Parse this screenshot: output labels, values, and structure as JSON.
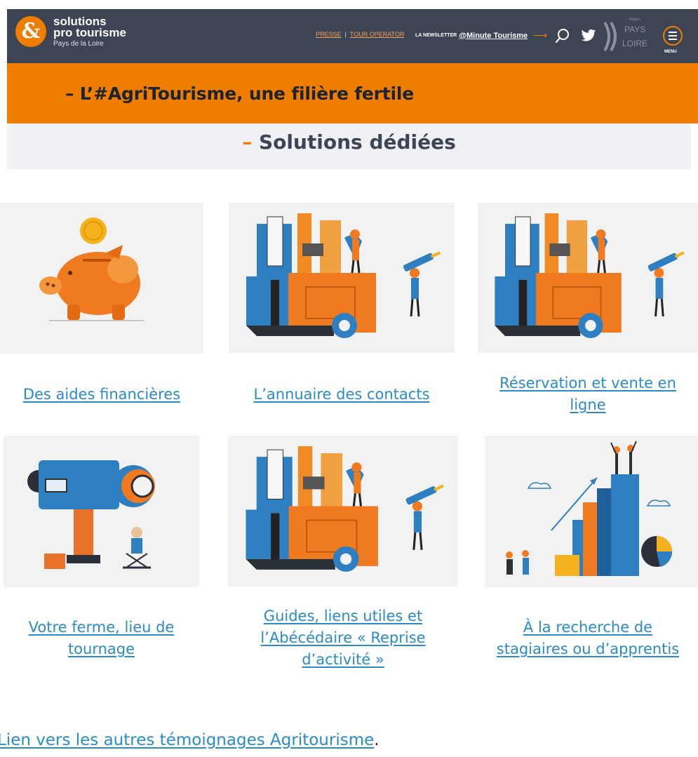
{
  "header": {
    "logo_symbol": "&",
    "logo_line1": "solutions",
    "logo_line2": "pro tourisme",
    "logo_sub": "Pays de la Loire",
    "link_presse": "PRESSE",
    "separator": "|",
    "link_tour_operator": "TOUR OPERATOR",
    "newsletter_prefix": "LA NEWSLETTER",
    "newsletter_name": "@Minute Tourisme",
    "newsletter_arrow": "⟶",
    "region_word": "Région",
    "region_pays": "PAYS",
    "region_loire": "LOIRE",
    "menu_label": "MENU",
    "accent_color": "#ef7d00",
    "bar_color": "#3d4453",
    "icons": [
      "search-icon",
      "twitter-icon",
      "menu-icon"
    ]
  },
  "banner": {
    "title": "– L’#AgriTourisme, une filière fertile"
  },
  "section": {
    "dash": "–",
    "title": "Solutions dédiées"
  },
  "cards": [
    {
      "line1": "Des aides financières",
      "line2": "",
      "line3": "",
      "illustration": "piggy-bank"
    },
    {
      "line1": "L’annuaire des contacts",
      "line2": "",
      "line3": "",
      "illustration": "toolbox"
    },
    {
      "line1": "Réservation et vente en",
      "line2": "ligne",
      "line3": "",
      "illustration": "toolbox"
    },
    {
      "line1": "Votre ferme, lieu de",
      "line2": "tournage",
      "line3": "",
      "illustration": "camera"
    },
    {
      "line1": "Guides, liens utiles et",
      "line2": "l’Abécédaire « Reprise",
      "line3": "d’activité »",
      "illustration": "toolbox"
    },
    {
      "line1": "À la recherche de",
      "line2": "stagiaires ou d’apprentis",
      "line3": "",
      "illustration": "growth-chart"
    }
  ],
  "footer": {
    "link_text": "Lien vers les autres témoignages Agritourisme",
    "trailing": "."
  },
  "link_color": "#2a8bc9"
}
